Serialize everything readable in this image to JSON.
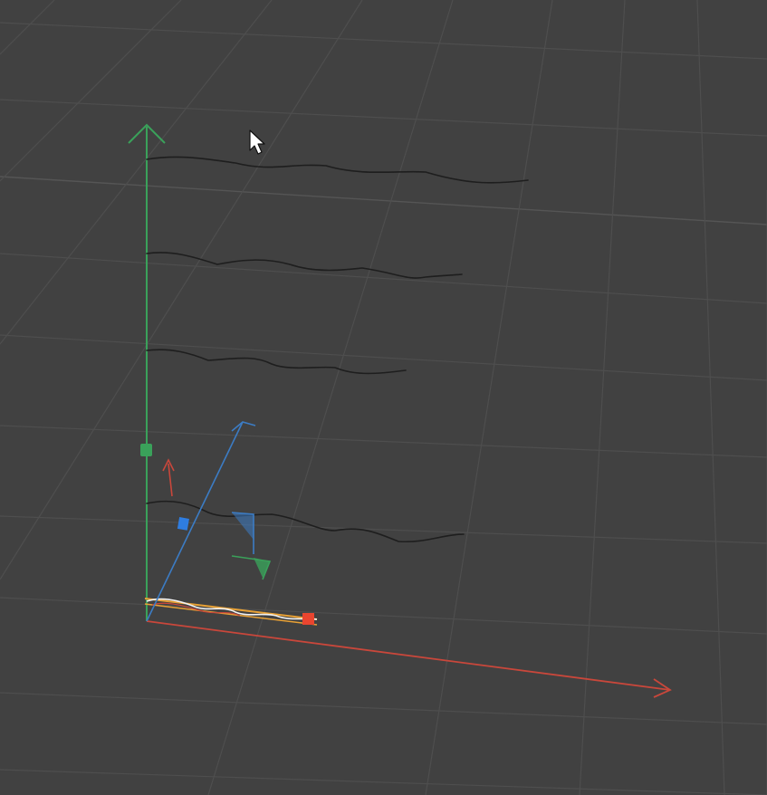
{
  "viewport": {
    "background_color": "#414141",
    "grid_color": "#4e4e4e",
    "cursor_icon": "arrow-cursor-icon"
  },
  "world_axes": {
    "x_axis_color": "#c9473b",
    "y_axis_color": "#3aa15a"
  },
  "gizmo": {
    "x_color": "#c9473b",
    "y_color": "#3aa15a",
    "z_color": "#3c7cc4",
    "selection_color": "#e8a135"
  },
  "splines": {
    "count_visible": 5,
    "color": "#1e1e1e",
    "selected_color": "#f2f2f2"
  }
}
